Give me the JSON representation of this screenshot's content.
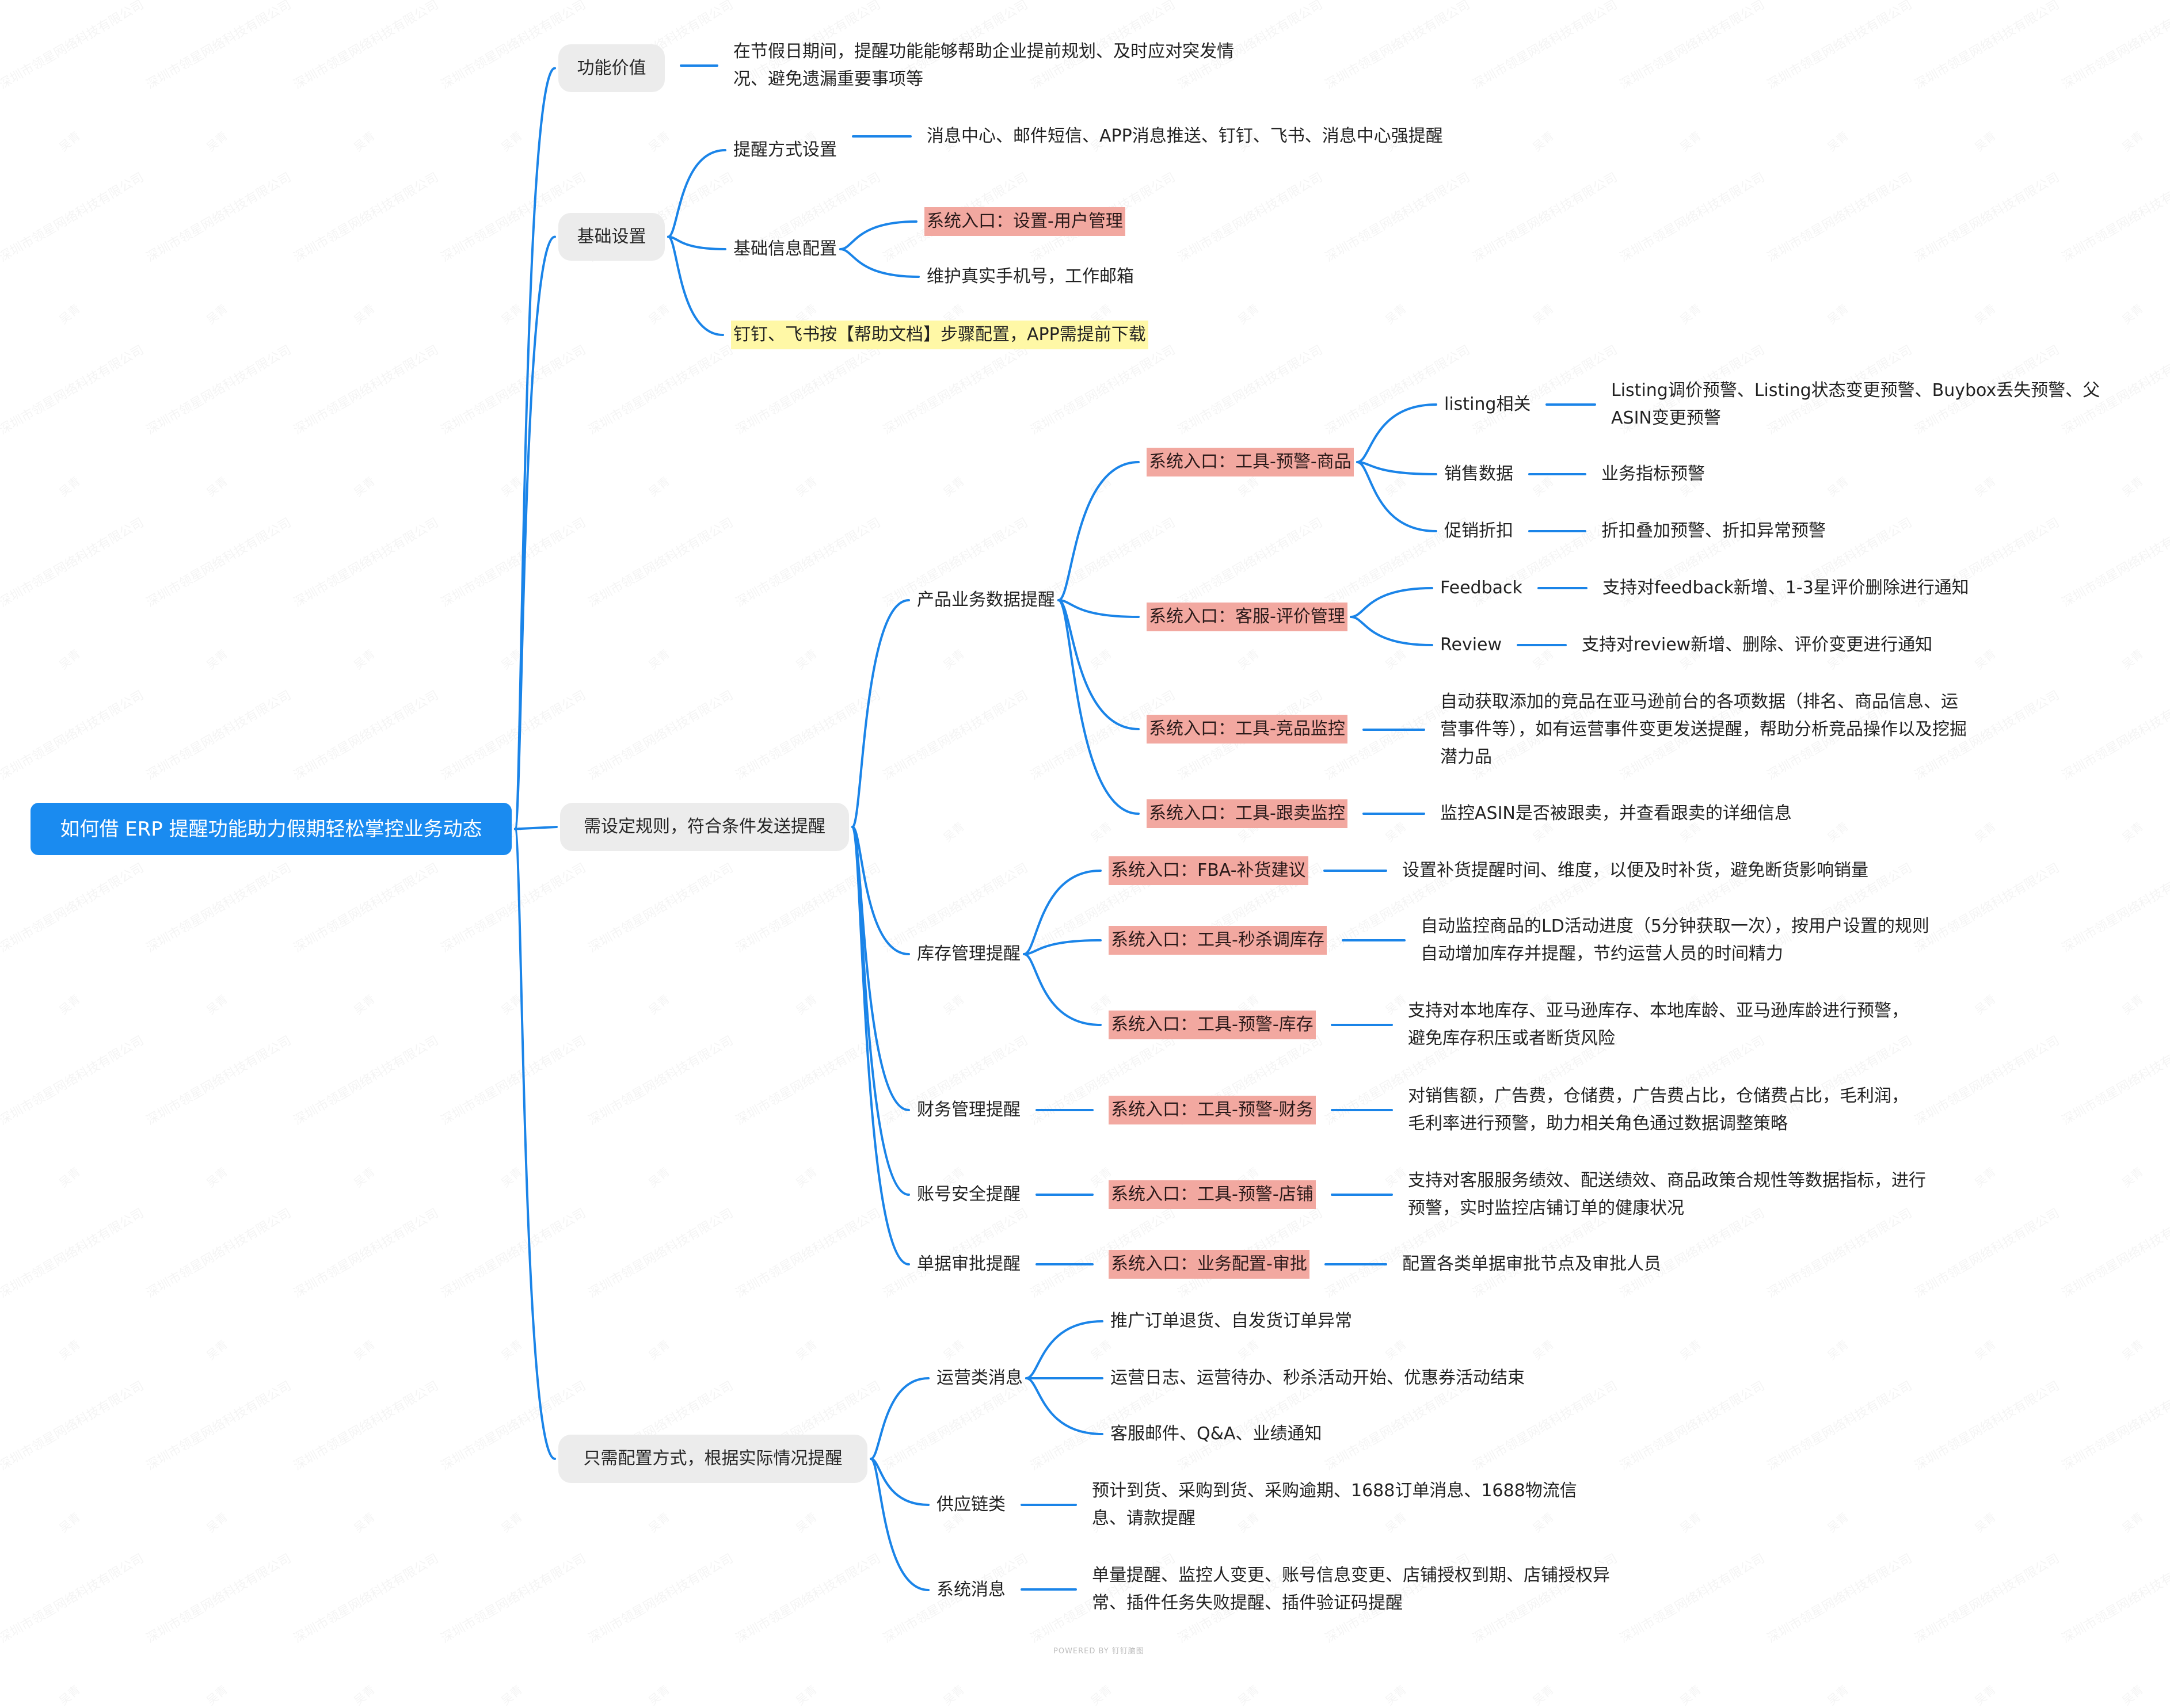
{
  "title": "如何借 ERP 提醒功能助力假期轻松掌控业务动态",
  "colors": {
    "root_bg": "#1a8bf0",
    "connector": "#1a84e8",
    "category_bg": "#ececec",
    "system_entry_highlight": "#f2a8a0",
    "note_highlight": "#fff8a6"
  },
  "watermark": {
    "company": "深圳市领星网络科技有限公司",
    "user": "吴青"
  },
  "footer": "POWERED BY 钉钉脑图",
  "branches": {
    "value": {
      "label": "功能价值",
      "desc": "在节假日期间，提醒功能能够帮助企业提前规划、及时应对突发情况、避免遗漏重要事项等"
    },
    "basic": {
      "label": "基础设置",
      "method": {
        "label": "提醒方式设置",
        "desc": "消息中心、邮件短信、APP消息推送、钉钉、飞书、消息中心强提醒"
      },
      "info": {
        "label": "基础信息配置",
        "entry": "系统入口：设置-用户管理",
        "desc": "维护真实手机号，工作邮箱"
      },
      "note": "钉钉、飞书按【帮助文档】步骤配置，APP需提前下载"
    },
    "rules": {
      "label": "需设定规则，符合条件发送提醒",
      "product": {
        "label": "产品业务数据提醒",
        "entries": [
          {
            "entry": "系统入口：工具-预警-商品",
            "items": [
              {
                "label": "listing相关",
                "desc": "Listing调价预警、Listing状态变更预警、Buybox丢失预警、父ASIN变更预警"
              },
              {
                "label": "销售数据",
                "desc": "业务指标预警"
              },
              {
                "label": "促销折扣",
                "desc": "折扣叠加预警、折扣异常预警"
              }
            ]
          },
          {
            "entry": "系统入口：客服-评价管理",
            "items": [
              {
                "label": "Feedback",
                "desc": "支持对feedback新增、1-3星评价删除进行通知"
              },
              {
                "label": "Review",
                "desc": "支持对review新增、删除、评价变更进行通知"
              }
            ]
          },
          {
            "entry": "系统入口：工具-竞品监控",
            "desc": "自动获取添加的竞品在亚马逊前台的各项数据（排名、商品信息、运营事件等），如有运营事件变更发送提醒，帮助分析竞品操作以及挖掘潜力品"
          },
          {
            "entry": "系统入口：工具-跟卖监控",
            "desc": "监控ASIN是否被跟卖，并查看跟卖的详细信息"
          }
        ]
      },
      "inventory": {
        "label": "库存管理提醒",
        "entries": [
          {
            "entry": "系统入口：FBA-补货建议",
            "desc": "设置补货提醒时间、维度，以便及时补货，避免断货影响销量"
          },
          {
            "entry": "系统入口：工具-秒杀调库存",
            "desc": "自动监控商品的LD活动进度（5分钟获取一次），按用户设置的规则自动增加库存并提醒，节约运营人员的时间精力"
          },
          {
            "entry": "系统入口：工具-预警-库存",
            "desc": "支持对本地库存、亚马逊库存、本地库龄、亚马逊库龄进行预警，避免库存积压或者断货风险"
          }
        ]
      },
      "finance": {
        "label": "财务管理提醒",
        "entry": "系统入口：工具-预警-财务",
        "desc": "对销售额，广告费，仓储费，广告费占比，仓储费占比，毛利润，毛利率进行预警，助力相关角色通过数据调整策略"
      },
      "account": {
        "label": "账号安全提醒",
        "entry": "系统入口：工具-预警-店铺",
        "desc": "支持对客服服务绩效、配送绩效、商品政策合规性等数据指标，进行预警，实时监控店铺订单的健康状况"
      },
      "approval": {
        "label": "单据审批提醒",
        "entry": "系统入口：业务配置-审批",
        "desc": "配置各类单据审批节点及审批人员"
      }
    },
    "config": {
      "label": "只需配置方式，根据实际情况提醒",
      "operations": {
        "label": "运营类消息",
        "items": [
          "推广订单退货、自发货订单异常",
          "运营日志、运营待办、秒杀活动开始、优惠券活动结束",
          "客服邮件、Q&A、业绩通知"
        ]
      },
      "supply": {
        "label": "供应链类",
        "desc": "预计到货、采购到货、采购逾期、1688订单消息、1688物流信息、请款提醒"
      },
      "system": {
        "label": "系统消息",
        "desc": "单量提醒、监控人变更、账号信息变更、店铺授权到期、店铺授权异常、插件任务失败提醒、插件验证码提醒"
      }
    }
  }
}
